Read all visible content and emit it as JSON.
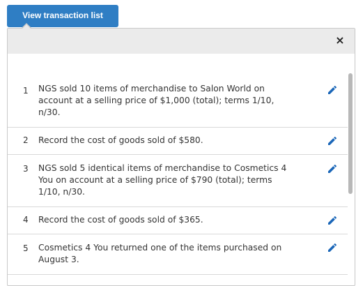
{
  "view_button": {
    "label": "View transaction list"
  },
  "panel": {
    "close_symbol": "×",
    "close_icon": "close-icon"
  },
  "transactions": [
    {
      "number": "1",
      "line1": "NGS sold 10 items of merchandise to Salon World on",
      "line2": "account at a selling price of $1,000 (total); terms 1/10,",
      "line3": "n/30."
    },
    {
      "number": "2",
      "line1": "Record the cost of goods sold of $580.",
      "line2": "",
      "line3": ""
    },
    {
      "number": "3",
      "line1": "NGS sold 5 identical items of merchandise to Cosmetics 4",
      "line2": "You on account at a selling price of $790 (total); terms",
      "line3": "1/10, n/30."
    },
    {
      "number": "4",
      "line1": "Record the cost of goods sold of $365.",
      "line2": "",
      "line3": ""
    },
    {
      "number": "5",
      "line1": "Cosmetics 4 You returned one of the items purchased on",
      "line2": "August 3.",
      "line3": ""
    }
  ],
  "colors": {
    "accent": "#2f7ec4",
    "edit_icon": "#1a66b8"
  }
}
